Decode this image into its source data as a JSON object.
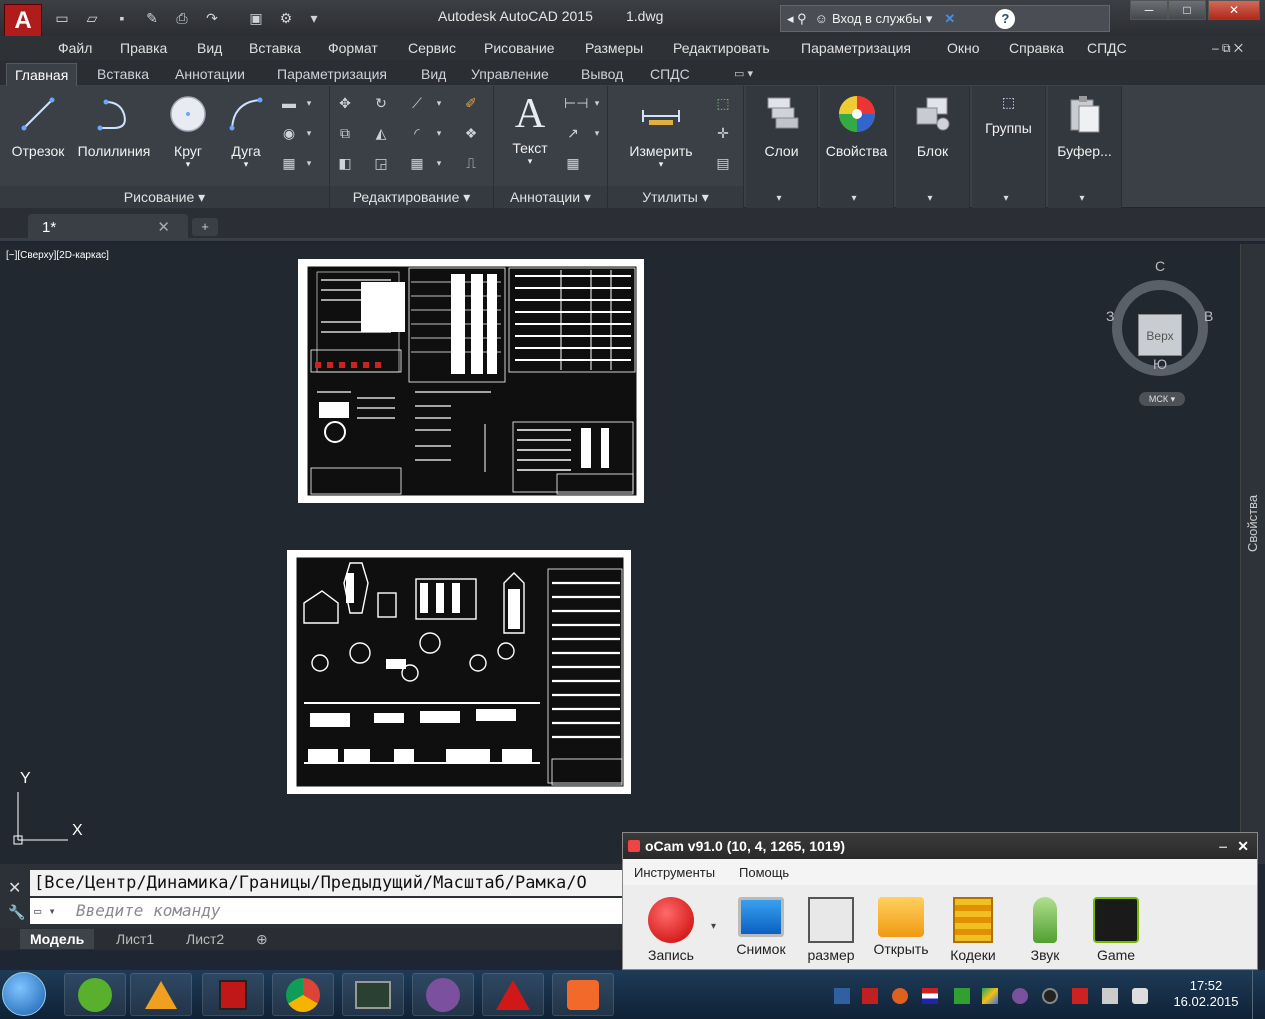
{
  "app": {
    "logo": "A",
    "title": "Autodesk AutoCAD 2015",
    "file": "1.dwg",
    "search_label": "Вход в службы"
  },
  "menu": [
    "Файл",
    "Правка",
    "Вид",
    "Вставка",
    "Формат",
    "Сервис",
    "Рисование",
    "Размеры",
    "Редактировать",
    "Параметризация",
    "Окно",
    "Справка",
    "СПДС"
  ],
  "ribbon_tabs": [
    "Главная",
    "Вставка",
    "Аннотации",
    "Параметризация",
    "Вид",
    "Управление",
    "Вывод",
    "СПДС"
  ],
  "ribbon": {
    "draw_tools": [
      "Отрезок",
      "Полилиния",
      "Круг",
      "Дуга"
    ],
    "draw_panel": "Рисование",
    "modify_panel": "Редактирование",
    "annot_tool": "Текст",
    "annot_panel": "Аннотации",
    "util_tool": "Измерить",
    "util_panel": "Утилиты",
    "layers": "Слои",
    "properties": "Свойства",
    "block": "Блок",
    "groups": "Группы",
    "buffer": "Буфер..."
  },
  "file_tab": "1*",
  "viewport": {
    "label": "[−][Сверху][2D-каркас]",
    "cube_top": "Верх",
    "dir_n": "С",
    "dir_s": "Ю",
    "dir_w": "З",
    "dir_e": "В",
    "wcs": "МСК",
    "axis_y": "Y",
    "axis_x": "X",
    "side_panel": "Свойства"
  },
  "command": {
    "history": "[Все/Центр/Динамика/Границы/Предыдущий/Масштаб/Рамка/О",
    "placeholder": "Введите команду"
  },
  "layout_tabs": [
    "Модель",
    "Лист1",
    "Лист2"
  ],
  "ocam": {
    "title": "oCam v91.0 (10, 4, 1265, 1019)",
    "menu": [
      "Инструменты",
      "Помощь"
    ],
    "tools": [
      "Запись",
      "Снимок",
      "размер",
      "Открыть",
      "Кодеки",
      "Звук",
      "Game"
    ]
  },
  "tray": {
    "time": "17:52",
    "date": "16.02.2015"
  },
  "colors": {
    "accent": "#b01c1c",
    "viewport_bg": "#212830",
    "ribbon_bg": "#3b4047"
  }
}
